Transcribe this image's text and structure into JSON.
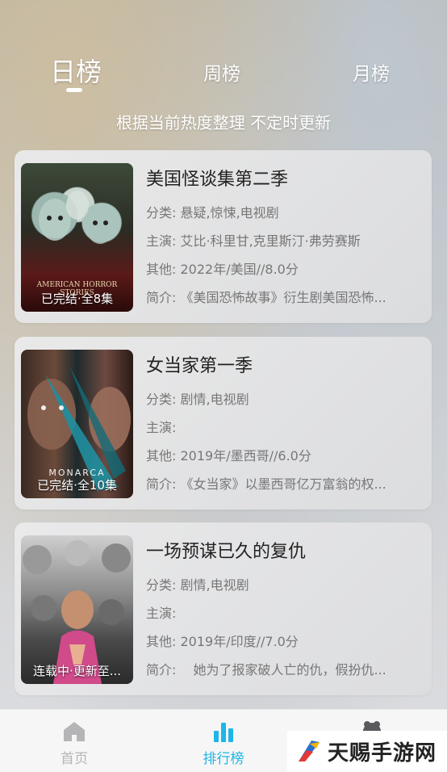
{
  "tabs": {
    "day": "日榜",
    "week": "周榜",
    "month": "月榜"
  },
  "subtitle": "根据当前热度整理 不定时更新",
  "labels": {
    "category": "分类:",
    "cast": "主演:",
    "other": "其他:",
    "intro": "简介:"
  },
  "items": [
    {
      "title": "美国怪谈集第二季",
      "category": "悬疑,惊悚,电视剧",
      "cast": "艾比·科里甘,克里斯汀·弗劳赛斯",
      "other": "2022年/美国//8.0分",
      "intro": "《美国恐怖故事》衍生剧美国恐怖...",
      "status": "已完结·全8集",
      "poster_text": "AMERICAN HORROR STORIES"
    },
    {
      "title": "女当家第一季",
      "category": "剧情,电视剧",
      "cast": "",
      "other": "2019年/墨西哥//6.0分",
      "intro": "《女当家》以墨西哥亿万富翁的权...",
      "status": "已完结·全10集",
      "poster_text": "MONARCA"
    },
    {
      "title": "一场预谋已久的复仇",
      "category": "剧情,电视剧",
      "cast": "",
      "other": "2019年/印度//7.0分",
      "intro": "　她为了报家破人亡的仇，假扮仇...",
      "status": "连载中·更新至...",
      "poster_text": ""
    }
  ],
  "nav": {
    "home": "首页",
    "rank": "排行榜"
  },
  "watermark": "天赐手游网",
  "colors": {
    "accent": "#1db6e6",
    "title": "#222222",
    "meta": "#777777"
  }
}
